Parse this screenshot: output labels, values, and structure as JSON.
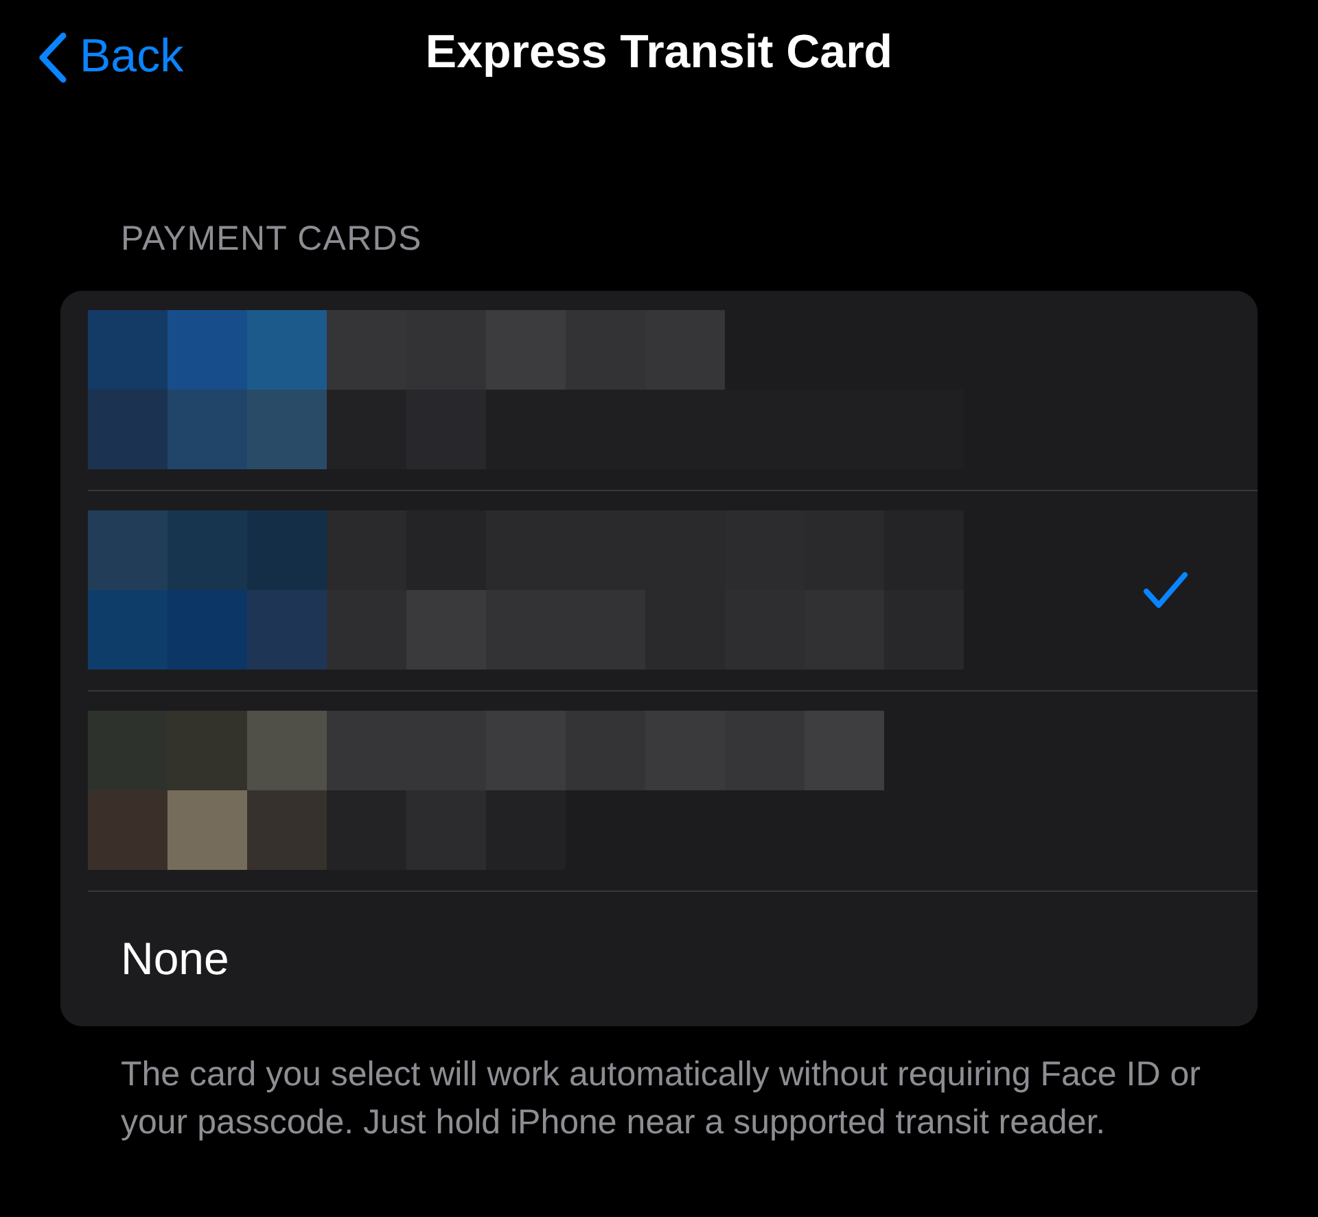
{
  "nav": {
    "back": "Back",
    "title": "Express Transit Card"
  },
  "section": {
    "header": "PAYMENT CARDS",
    "rows": [
      {
        "kind": "picture",
        "selected": false
      },
      {
        "kind": "picture",
        "selected": true
      },
      {
        "kind": "picture",
        "selected": false
      },
      {
        "kind": "text",
        "label": "None",
        "selected": false
      }
    ],
    "footer": "The card you select will work automatically without requiring Face ID or your passcode. Just hold iPhone near a supported transit reader."
  }
}
